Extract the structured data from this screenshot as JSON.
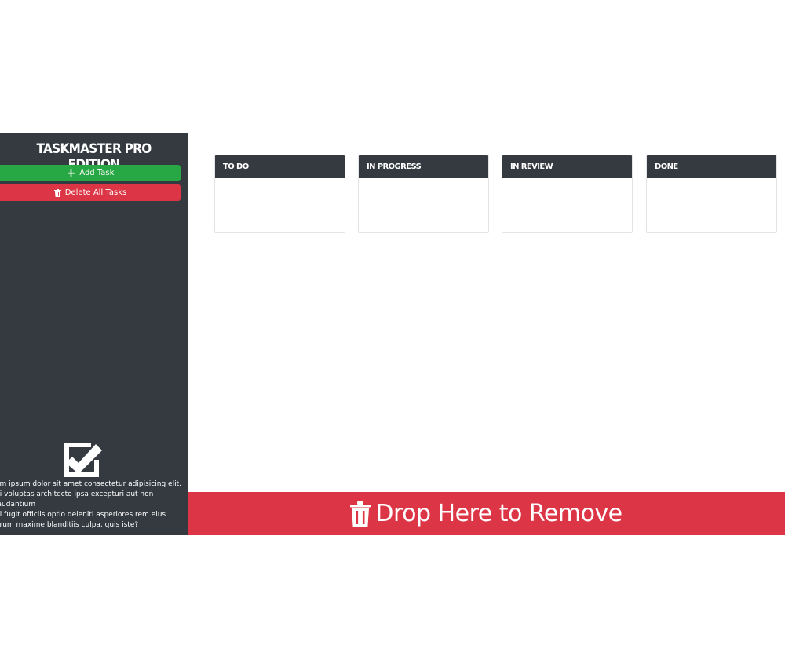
{
  "sidebar": {
    "title": "TASKMASTER PRO EDITION",
    "add_task_label": "Add Task",
    "delete_all_label": "Delete All Tasks",
    "description": "em ipsum dolor sit amet consectetur adipisicing elit.\ndi voluptas architecto ipsa excepturi aut non laudantium\nui fugit officiis optio deleniti asperiores rem eius\norum maxime blanditiis culpa, quis iste?"
  },
  "board": {
    "columns": [
      {
        "label": "TO DO"
      },
      {
        "label": "IN PROGRESS"
      },
      {
        "label": "IN REVIEW"
      },
      {
        "label": "DONE"
      }
    ]
  },
  "dropzone": {
    "label": "Drop Here to Remove"
  },
  "icons": {
    "add": "plus-icon",
    "delete": "trash-icon",
    "logo": "checkbox-icon",
    "dropzone": "trash-icon"
  },
  "colors": {
    "sidebar_bg": "#343a40",
    "success": "#28a745",
    "danger": "#dc3545",
    "column_header_bg": "#343a40"
  }
}
